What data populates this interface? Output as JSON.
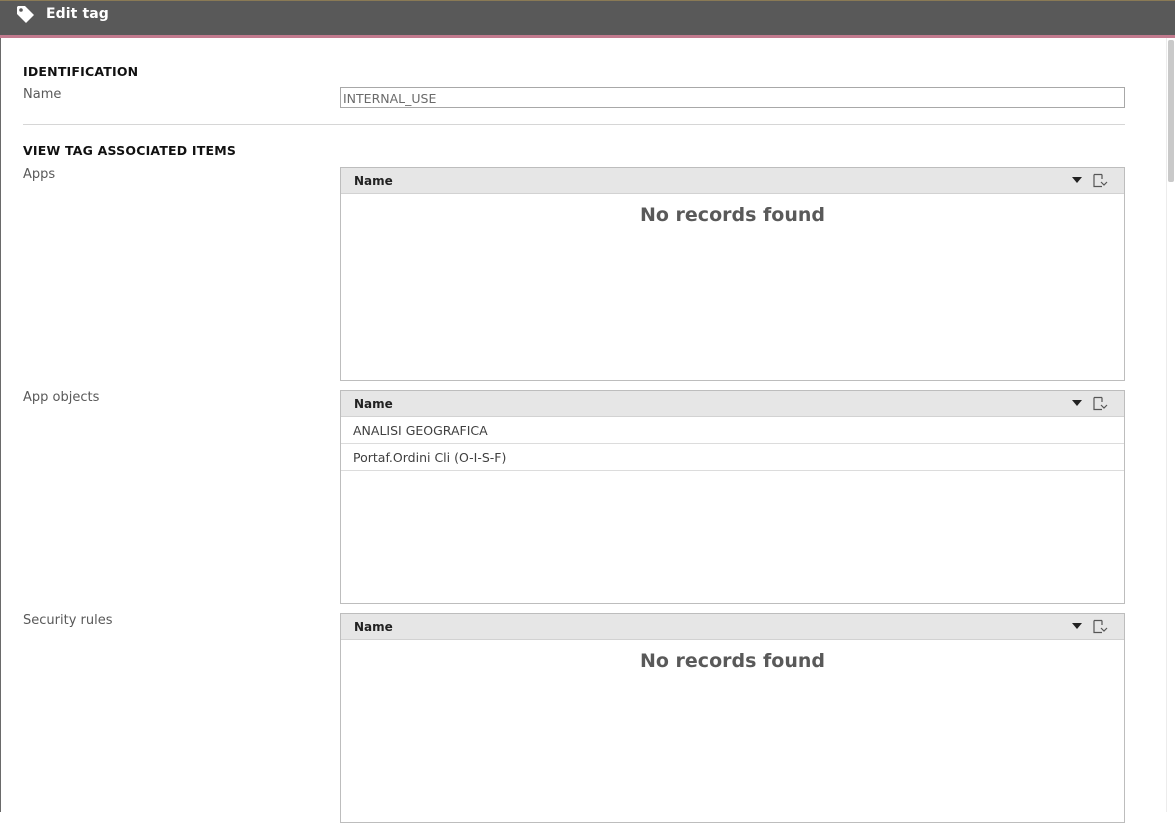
{
  "window": {
    "title": "Edit tag",
    "icon": "tag-icon"
  },
  "identification": {
    "header": "IDENTIFICATION",
    "name_label": "Name",
    "name_value": "INTERNAL_USE"
  },
  "associated": {
    "header": "VIEW TAG ASSOCIATED ITEMS",
    "apps": {
      "label": "Apps",
      "column": "Name",
      "empty_message": "No records found",
      "rows": []
    },
    "app_objects": {
      "label": "App objects",
      "column": "Name",
      "rows": [
        "ANALISI GEOGRAFICA",
        "Portaf.Ordini Cli (O-I-S-F)"
      ]
    },
    "security_rules": {
      "label": "Security rules",
      "column": "Name",
      "empty_message": "No records found",
      "rows": []
    }
  },
  "colors": {
    "titlebar": "#595959",
    "accent": "#c27a8e",
    "grid_header": "#e6e6e6"
  }
}
